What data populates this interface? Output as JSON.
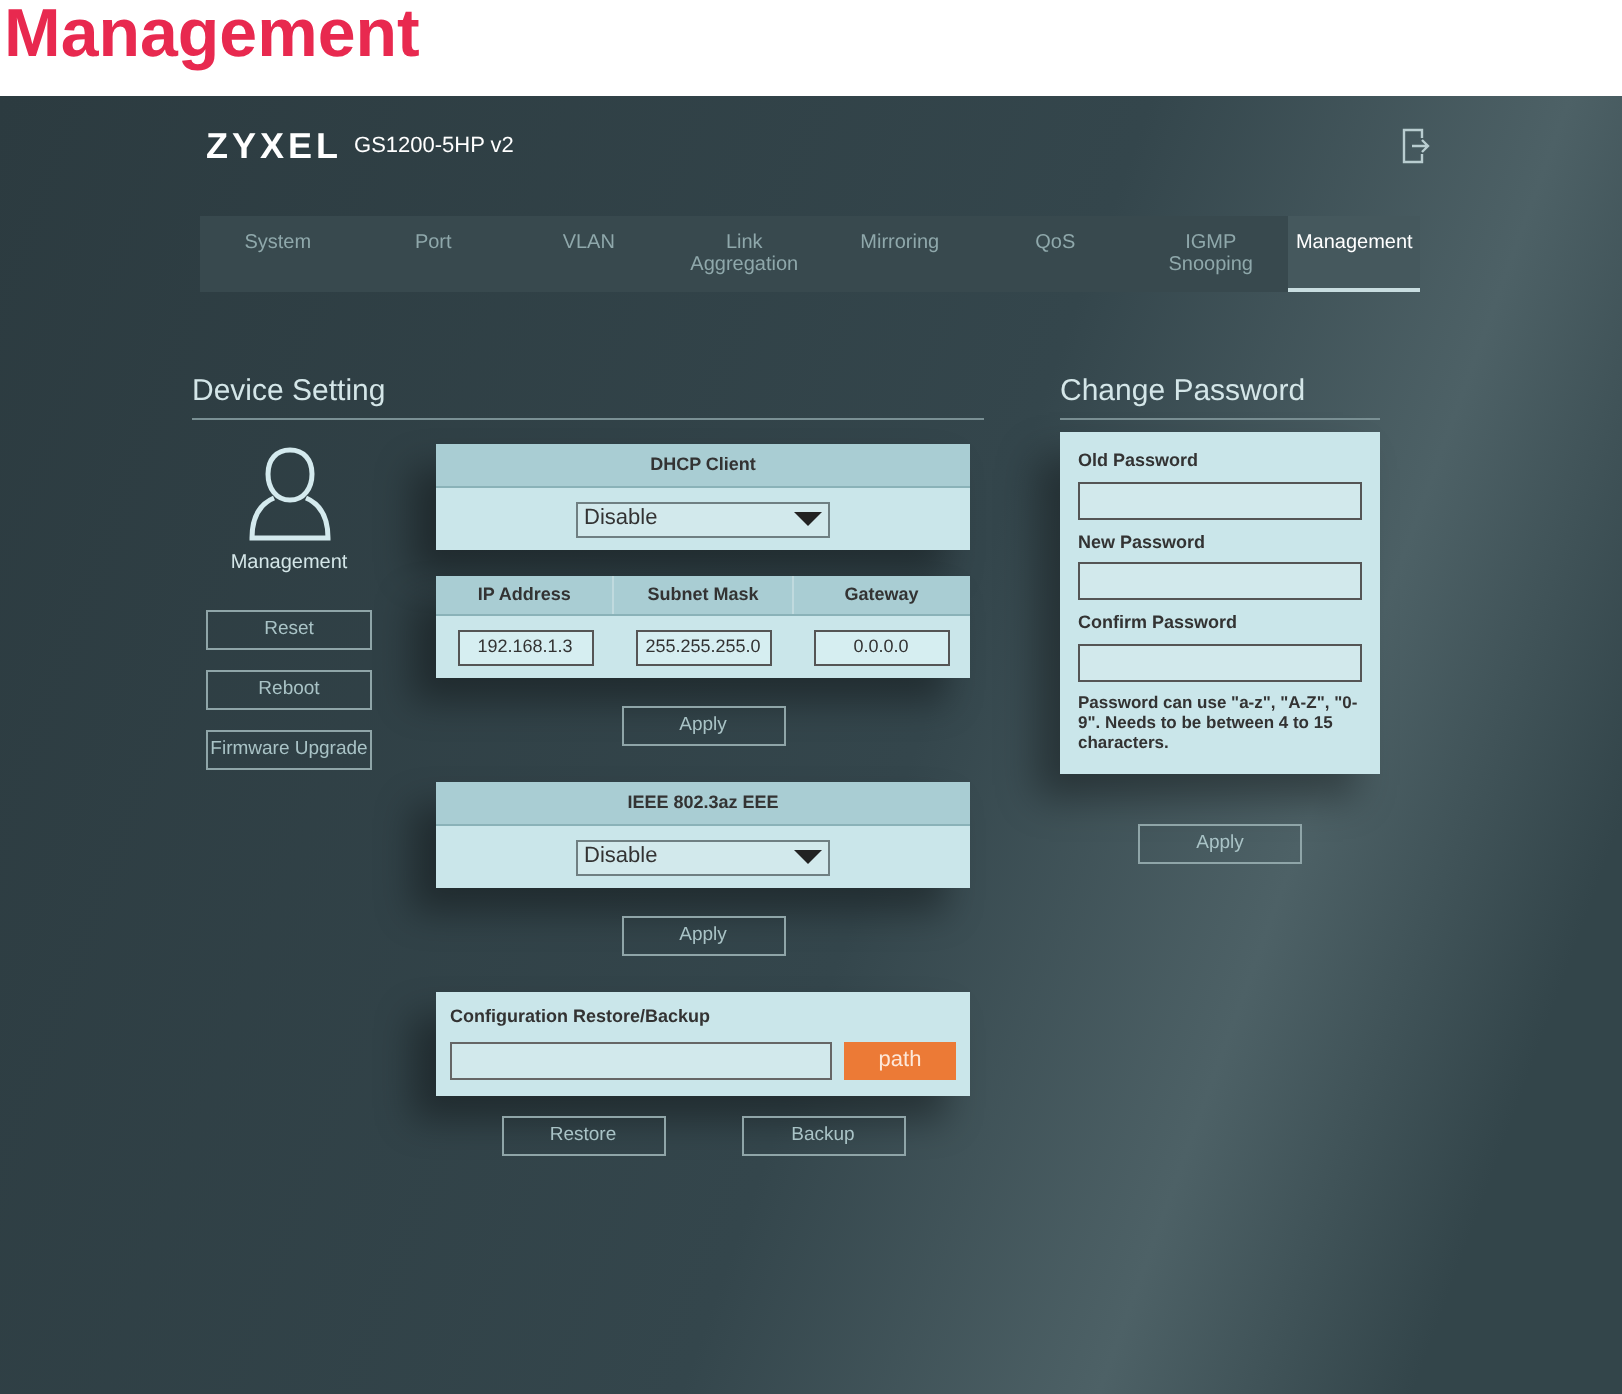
{
  "page_title": "Management",
  "header": {
    "brand": "ZYXEL",
    "model": "GS1200-5HP v2"
  },
  "tabs": [
    {
      "label": "System",
      "selected": false
    },
    {
      "label": "Port",
      "selected": false
    },
    {
      "label": "VLAN",
      "selected": false
    },
    {
      "label": "Link Aggregation",
      "selected": false
    },
    {
      "label": "Mirroring",
      "selected": false
    },
    {
      "label": "QoS",
      "selected": false
    },
    {
      "label": "IGMP Snooping",
      "selected": false
    },
    {
      "label": "Management",
      "selected": true
    }
  ],
  "device_setting": {
    "title": "Device Setting",
    "profile_label": "Management",
    "buttons": [
      "Reset",
      "Reboot",
      "Firmware Upgrade"
    ],
    "dhcp": {
      "title": "DHCP Client",
      "value": "Disable"
    },
    "ip_table": {
      "columns": [
        "IP Address",
        "Subnet Mask",
        "Gateway"
      ],
      "values": [
        "192.168.1.3",
        "255.255.255.0",
        "0.0.0.0"
      ]
    },
    "ip_apply": "Apply",
    "eee": {
      "title": "IEEE 802.3az EEE",
      "value": "Disable"
    },
    "eee_apply": "Apply",
    "config": {
      "title": "Configuration Restore/Backup",
      "path_button": "path",
      "buttons": [
        "Restore",
        "Backup"
      ]
    }
  },
  "change_password": {
    "title": "Change Password",
    "fields": [
      {
        "label": "Old Password"
      },
      {
        "label": "New Password"
      },
      {
        "label": "Confirm Password"
      }
    ],
    "hint": "Password can use \"a-z\", \"A-Z\", \"0-9\". Needs to be between 4 to 15 characters.",
    "apply": "Apply"
  }
}
